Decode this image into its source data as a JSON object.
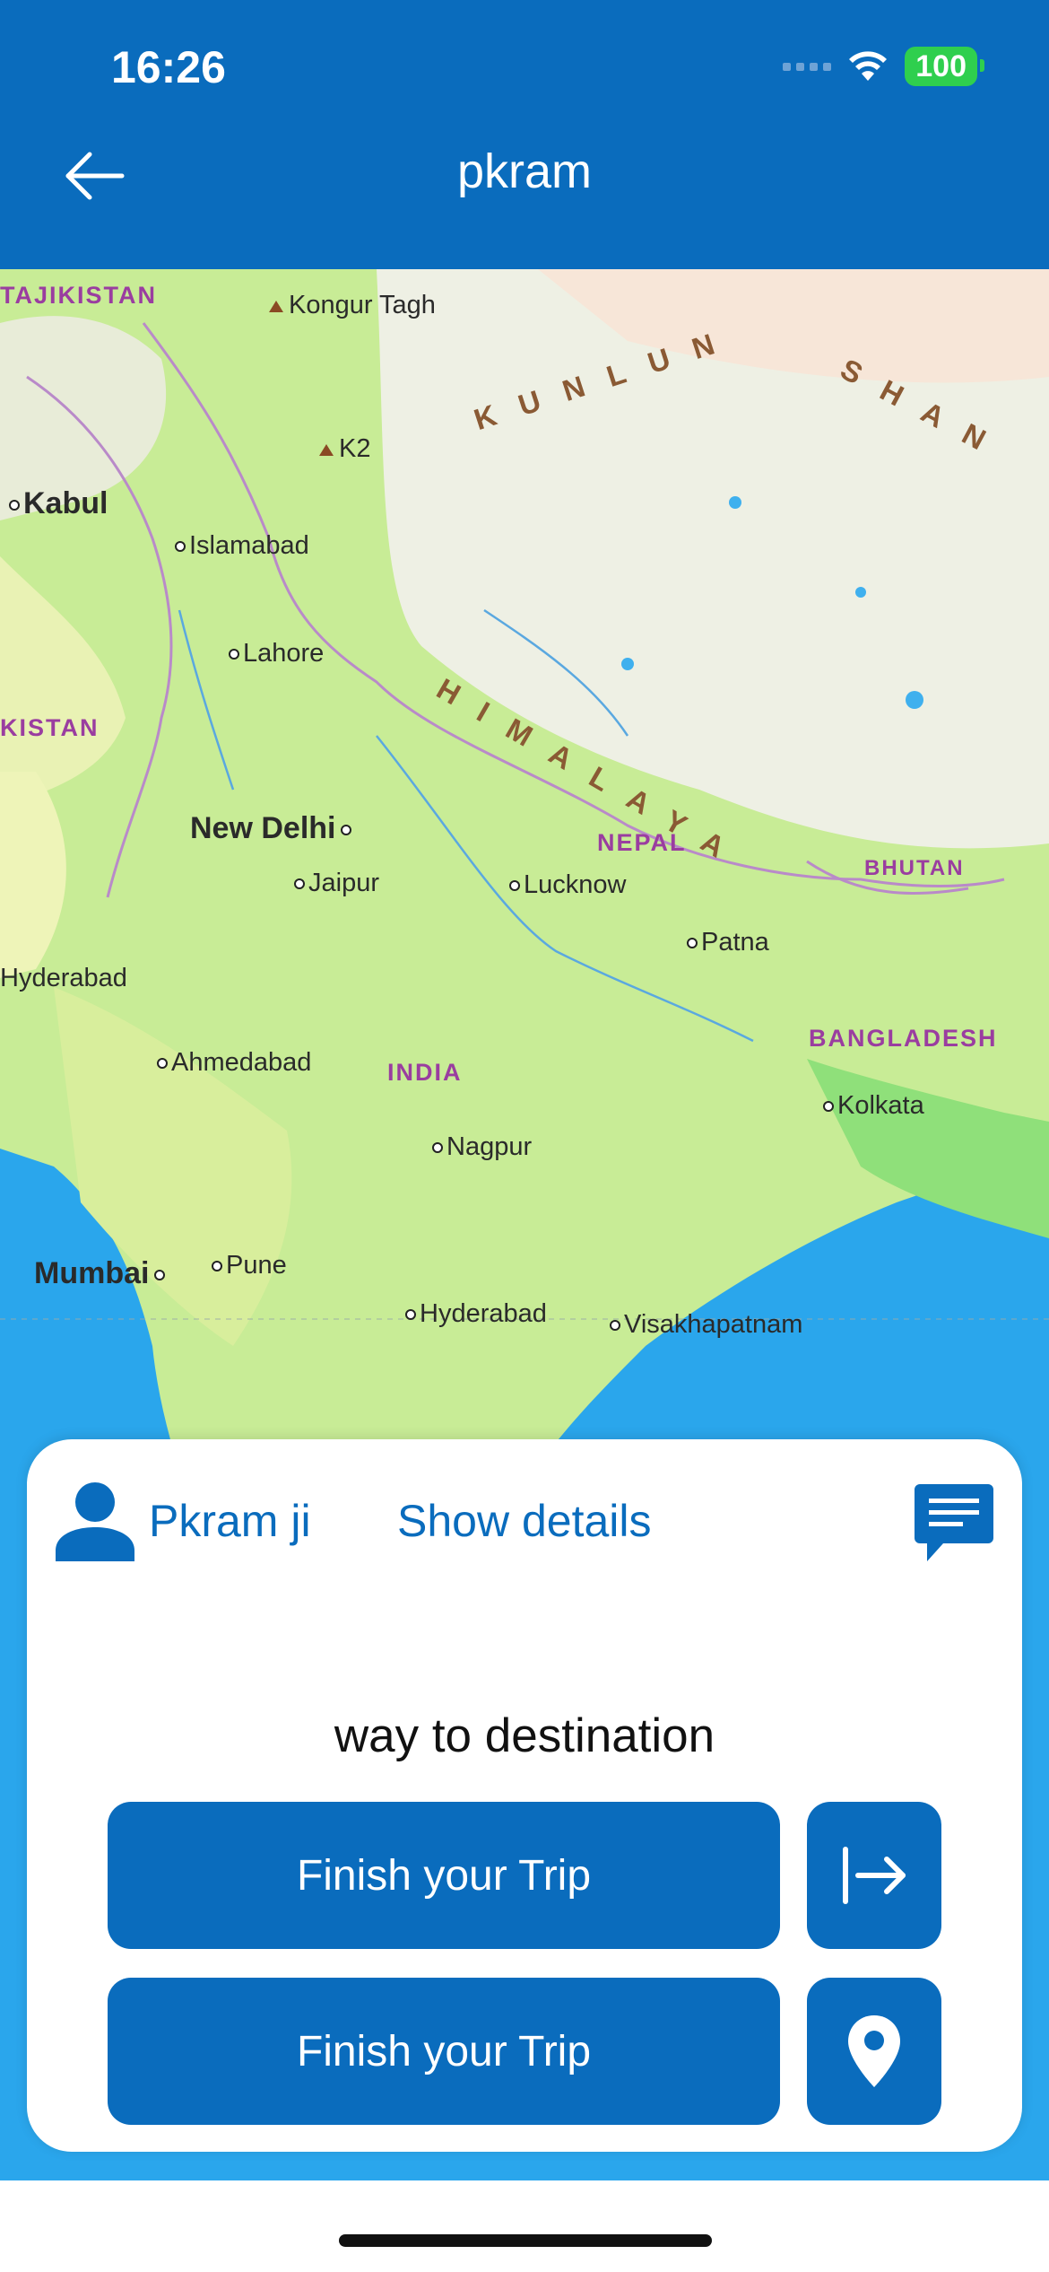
{
  "status_bar": {
    "time": "16:26",
    "battery": "100"
  },
  "header": {
    "title": "pkram",
    "back_icon": "arrow-left-icon"
  },
  "map": {
    "labels": {
      "tajikistan": "TAJIKISTAN",
      "kongur": "Kongur Tagh",
      "kunlun": "KUNLUN",
      "shan": "SHAN",
      "k2": "K2",
      "kabul": "Kabul",
      "islamabad": "Islamabad",
      "lahore": "Lahore",
      "kistan": "KISTAN",
      "himalaya": "HIMALAYA",
      "new_delhi": "New Delhi",
      "jaipur": "Jaipur",
      "lucknow": "Lucknow",
      "nepal": "NEPAL",
      "bhutan": "BHUTAN",
      "patna": "Patna",
      "hyderabad_pk": "Hyderabad",
      "ahmedabad": "Ahmedabad",
      "india": "INDIA",
      "bangladesh": "BANGLADESH",
      "kolkata": "Kolkata",
      "nagpur": "Nagpur",
      "mumbai": "Mumbai",
      "pune": "Pune",
      "hyderabad_in": "Hyderabad",
      "visakhapatnam": "Visakhapatnam"
    }
  },
  "card": {
    "user_name": "Pkram ji",
    "show_details": "Show details",
    "status_text": "way to destination",
    "buttons": [
      {
        "label": "Finish your Trip",
        "icon": "exit-arrow-icon"
      },
      {
        "label": "Finish your Trip",
        "icon": "location-pin-icon"
      }
    ]
  },
  "colors": {
    "primary": "#0a6cbd",
    "battery": "#2fcf4e"
  }
}
